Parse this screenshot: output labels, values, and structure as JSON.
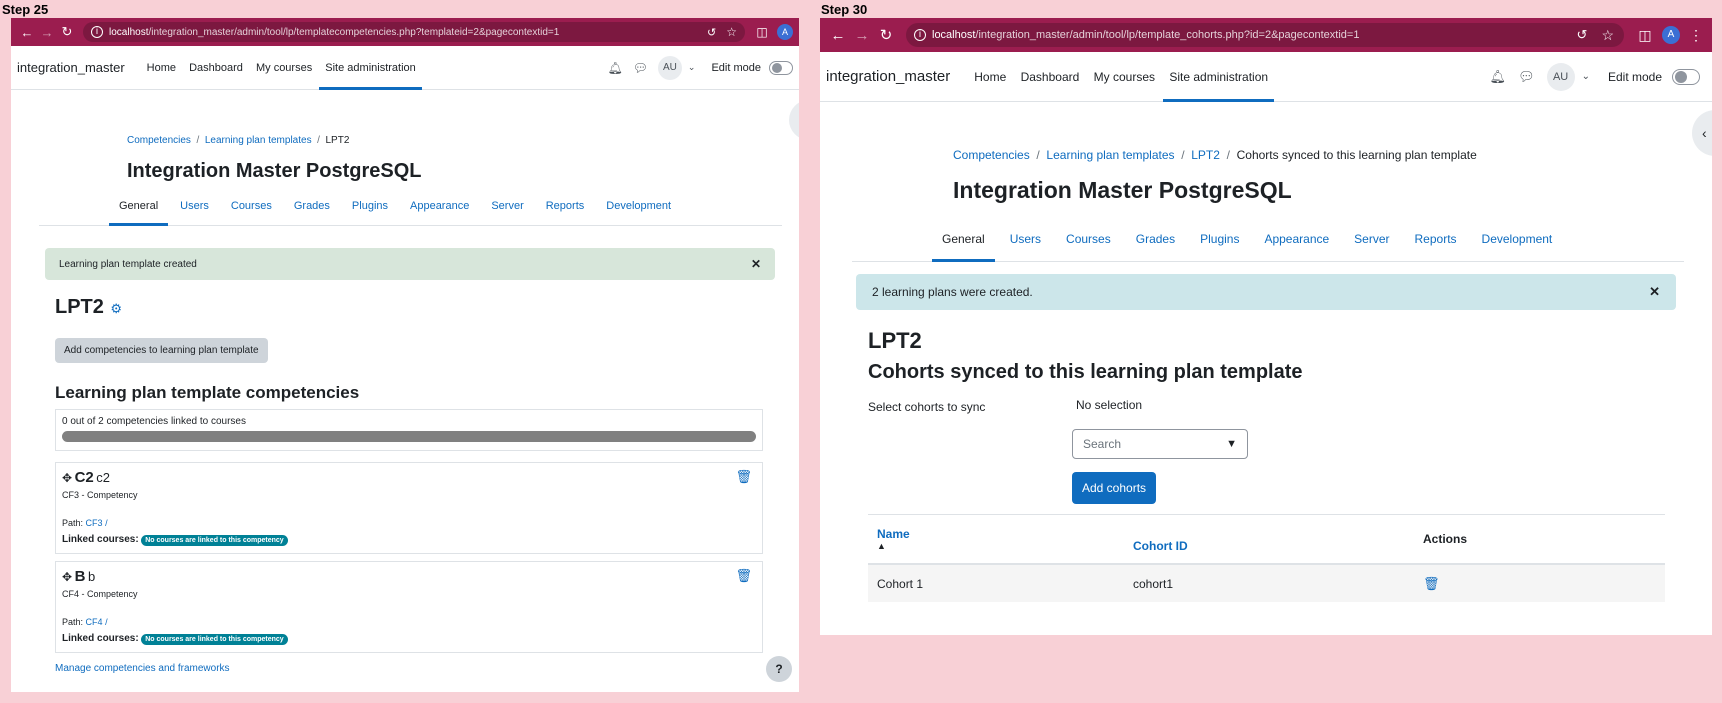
{
  "steps": {
    "left": "Step 25",
    "right": "Step 30"
  },
  "left": {
    "url_host": "localhost",
    "url_path": "/integration_master/admin/tool/lp/templatecompetencies.php?templateid=2&pagecontextid=1",
    "brand": "integration_master",
    "nav": [
      "Home",
      "Dashboard",
      "My courses",
      "Site administration"
    ],
    "avatar": "AU",
    "edit_mode": "Edit mode",
    "profile_letter": "A",
    "breadcrumb": [
      "Competencies",
      "Learning plan templates",
      "LPT2"
    ],
    "site_title": "Integration Master PostgreSQL",
    "tabs": [
      "General",
      "Users",
      "Courses",
      "Grades",
      "Plugins",
      "Appearance",
      "Server",
      "Reports",
      "Development"
    ],
    "alert": "Learning plan template created",
    "template_name": "LPT2",
    "add_button": "Add competencies to learning plan template",
    "section_heading": "Learning plan template competencies",
    "progress_text": "0 out of 2 competencies linked to courses",
    "progress_fraction": 0,
    "competencies": [
      {
        "shortname": "C2",
        "idnumber": "c2",
        "framework": "CF3 - Competency",
        "path_label": "Path:",
        "path_link": "CF3",
        "path_sep": "/",
        "linked_label": "Linked courses:",
        "badge": "No courses are linked to this competency"
      },
      {
        "shortname": "B",
        "idnumber": "b",
        "framework": "CF4 - Competency",
        "path_label": "Path:",
        "path_link": "CF4",
        "path_sep": "/",
        "linked_label": "Linked courses:",
        "badge": "No courses are linked to this competency"
      }
    ],
    "manage_link": "Manage competencies and frameworks",
    "help": "?"
  },
  "right": {
    "url_host": "localhost",
    "url_path": "/integration_master/admin/tool/lp/template_cohorts.php?id=2&pagecontextid=1",
    "brand": "integration_master",
    "nav": [
      "Home",
      "Dashboard",
      "My courses",
      "Site administration"
    ],
    "avatar": "AU",
    "edit_mode": "Edit mode",
    "profile_letter": "A",
    "breadcrumb": [
      "Competencies",
      "Learning plan templates",
      "LPT2",
      "Cohorts synced to this learning plan template"
    ],
    "site_title": "Integration Master PostgreSQL",
    "tabs": [
      "General",
      "Users",
      "Courses",
      "Grades",
      "Plugins",
      "Appearance",
      "Server",
      "Reports",
      "Development"
    ],
    "alert": "2 learning plans were created.",
    "template_name": "LPT2",
    "cohorts_heading": "Cohorts synced to this learning plan template",
    "select_label": "Select cohorts to sync",
    "no_selection": "No selection",
    "search_placeholder": "Search",
    "add_cohorts": "Add cohorts",
    "table_headers": {
      "name": "Name",
      "sort_arrow": "▲",
      "cohort_id": "Cohort ID",
      "actions": "Actions"
    },
    "rows": [
      {
        "name": "Cohort 1",
        "cohort_id": "cohort1"
      }
    ]
  },
  "colors": {
    "chrome": "#9b1d4f",
    "page_bg": "#f8d0d6",
    "link": "#0f6cbf",
    "success_alert": "#d7e6da",
    "info_alert": "#cce6ea",
    "badge": "#008196"
  }
}
